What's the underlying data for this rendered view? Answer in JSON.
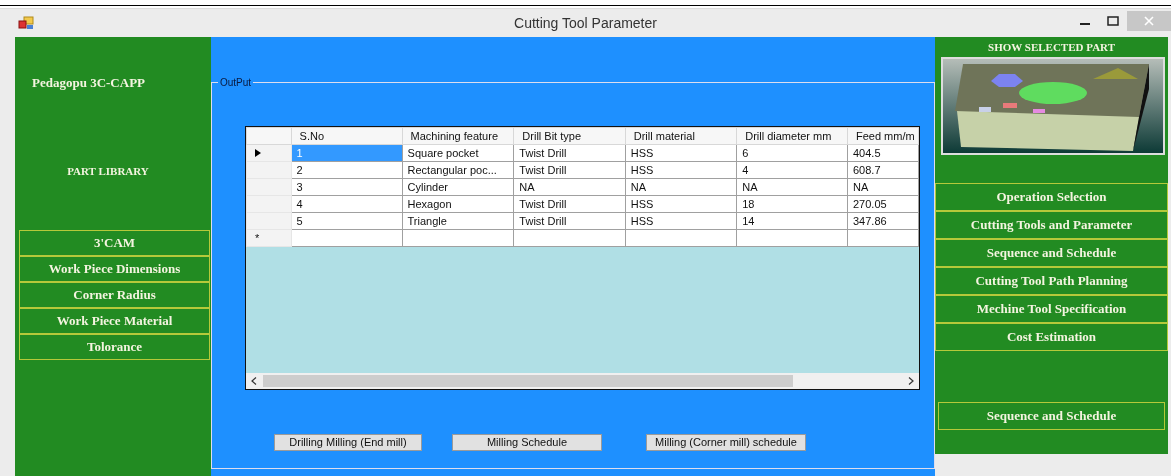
{
  "window": {
    "title": "Cutting Tool Parameter"
  },
  "left_panel": {
    "title": "Pedagopu 3C-CAPP",
    "section": "PART LIBRARY",
    "buttons": [
      "3'CAM",
      "Work Piece Dimensions",
      "Corner Radius",
      "Work Piece Material",
      "Tolorance"
    ]
  },
  "output": {
    "group_label": "OutPut",
    "table": {
      "columns": [
        "S.No",
        "Machining feature",
        "Drill Bit type",
        "Drill material",
        "Drill diameter mm",
        "Feed mm/m"
      ],
      "rows": [
        {
          "selected": true,
          "cells": [
            "1",
            "Square pocket",
            "Twist Drill",
            "HSS",
            "6",
            "404.5"
          ]
        },
        {
          "selected": false,
          "cells": [
            "2",
            "Rectangular poc...",
            "Twist Drill",
            "HSS",
            "4",
            "608.7"
          ]
        },
        {
          "selected": false,
          "cells": [
            "3",
            "Cylinder",
            "NA",
            "NA",
            "NA",
            "NA"
          ]
        },
        {
          "selected": false,
          "cells": [
            "4",
            "Hexagon",
            "Twist Drill",
            "HSS",
            "18",
            "270.05"
          ]
        },
        {
          "selected": false,
          "cells": [
            "5",
            "Triangle",
            "Twist Drill",
            "HSS",
            "14",
            "347.86"
          ]
        }
      ],
      "new_row_marker": "*"
    },
    "buttons": [
      "Drilling Milling (End mill)",
      "Milling Schedule",
      "Milling (Corner mill) schedule"
    ]
  },
  "right_panel": {
    "title": "SHOW SELECTED PART",
    "buttons": [
      "Operation Selection",
      "Cutting Tools and Parameter",
      "Sequence and Schedule",
      "Cutting Tool Path Planning",
      "Mechine Tool Specification",
      "Cost Estimation"
    ],
    "bottom_button": "Sequence and Schedule"
  }
}
